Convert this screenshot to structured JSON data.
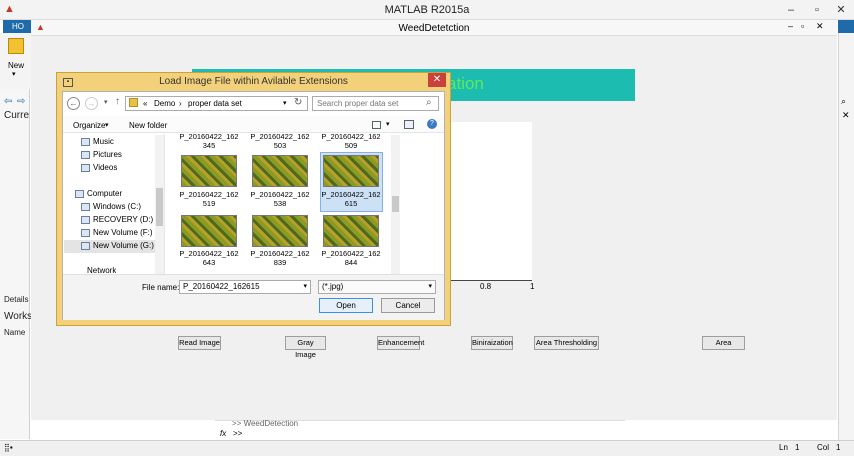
{
  "matlab": {
    "title": "MATLAB R2015a",
    "ribbon_tab": "HO",
    "new_label": "New",
    "left_labels": {
      "current": "Curre",
      "details": "Details",
      "workspace": "Works",
      "name": "Name"
    },
    "command_prompt": ">>",
    "command_prev": ">> WeedDetection",
    "fx": "fx",
    "status": {
      "ln_label": "Ln",
      "ln": "1",
      "col_label": "Col",
      "col": "1"
    }
  },
  "figure": {
    "title": "WeedDetetction",
    "banner_text": "ation",
    "x_ticks": [
      "0.8",
      "1"
    ],
    "buttons": [
      "Read Image",
      "Gray Image",
      "Enhancement",
      "Biniraization",
      "Area Thresholding",
      "Area"
    ]
  },
  "dialog": {
    "title": "Load Image File within Avilable Extensions",
    "breadcrumb": [
      "«",
      "Demo",
      "›",
      "proper data set"
    ],
    "search_placeholder": "Search proper data set",
    "toolbar": {
      "organize": "Organize",
      "new_folder": "New folder"
    },
    "nav_items": [
      {
        "label": "Music",
        "icon": "music-icon"
      },
      {
        "label": "Pictures",
        "icon": "pictures-icon"
      },
      {
        "label": "Videos",
        "icon": "videos-icon"
      },
      {
        "label": "Computer",
        "icon": "computer-icon"
      },
      {
        "label": "Windows (C:)",
        "icon": "drive-icon"
      },
      {
        "label": "RECOVERY (D:)",
        "icon": "drive-icon"
      },
      {
        "label": "New Volume (F:)",
        "icon": "drive-icon"
      },
      {
        "label": "New Volume (G:)",
        "icon": "drive-icon"
      },
      {
        "label": "Network",
        "icon": "network-icon"
      }
    ],
    "files": [
      "P_20160422_162345",
      "P_20160422_162503",
      "P_20160422_162509",
      "P_20160422_162519",
      "P_20160422_162538",
      "P_20160422_162615",
      "P_20160422_162643",
      "P_20160422_162839",
      "P_20160422_162844"
    ],
    "selected_file": "P_20160422_162615",
    "file_name_label": "File name:",
    "file_name_value": "P_20160422_162615",
    "file_type": "(*.jpg)",
    "open_label": "Open",
    "cancel_label": "Cancel"
  }
}
